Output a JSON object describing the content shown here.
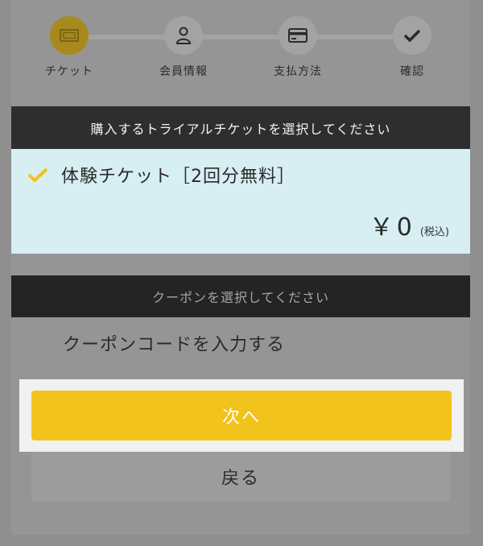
{
  "stepper": {
    "steps": [
      {
        "label": "チケット",
        "icon": "ticket-icon",
        "active": true
      },
      {
        "label": "会員情報",
        "icon": "user-icon",
        "active": false
      },
      {
        "label": "支払方法",
        "icon": "credit-card-icon",
        "active": false
      },
      {
        "label": "確認",
        "icon": "check-icon",
        "active": false
      }
    ]
  },
  "ticket": {
    "header": "購入するトライアルチケットを選択してください",
    "name": "体験チケット［2回分無料］",
    "currency": "￥",
    "price": "0",
    "tax_note": "(税込)",
    "check_color": "#f2c31d"
  },
  "coupon": {
    "header": "クーポンを選択してください",
    "link": "クーポンコードを入力する"
  },
  "buttons": {
    "next": "次へ",
    "back": "戻る"
  },
  "colors": {
    "accent": "#f2c31d",
    "card_bg": "#d7eef2",
    "header_bg": "#2e2e2e"
  }
}
